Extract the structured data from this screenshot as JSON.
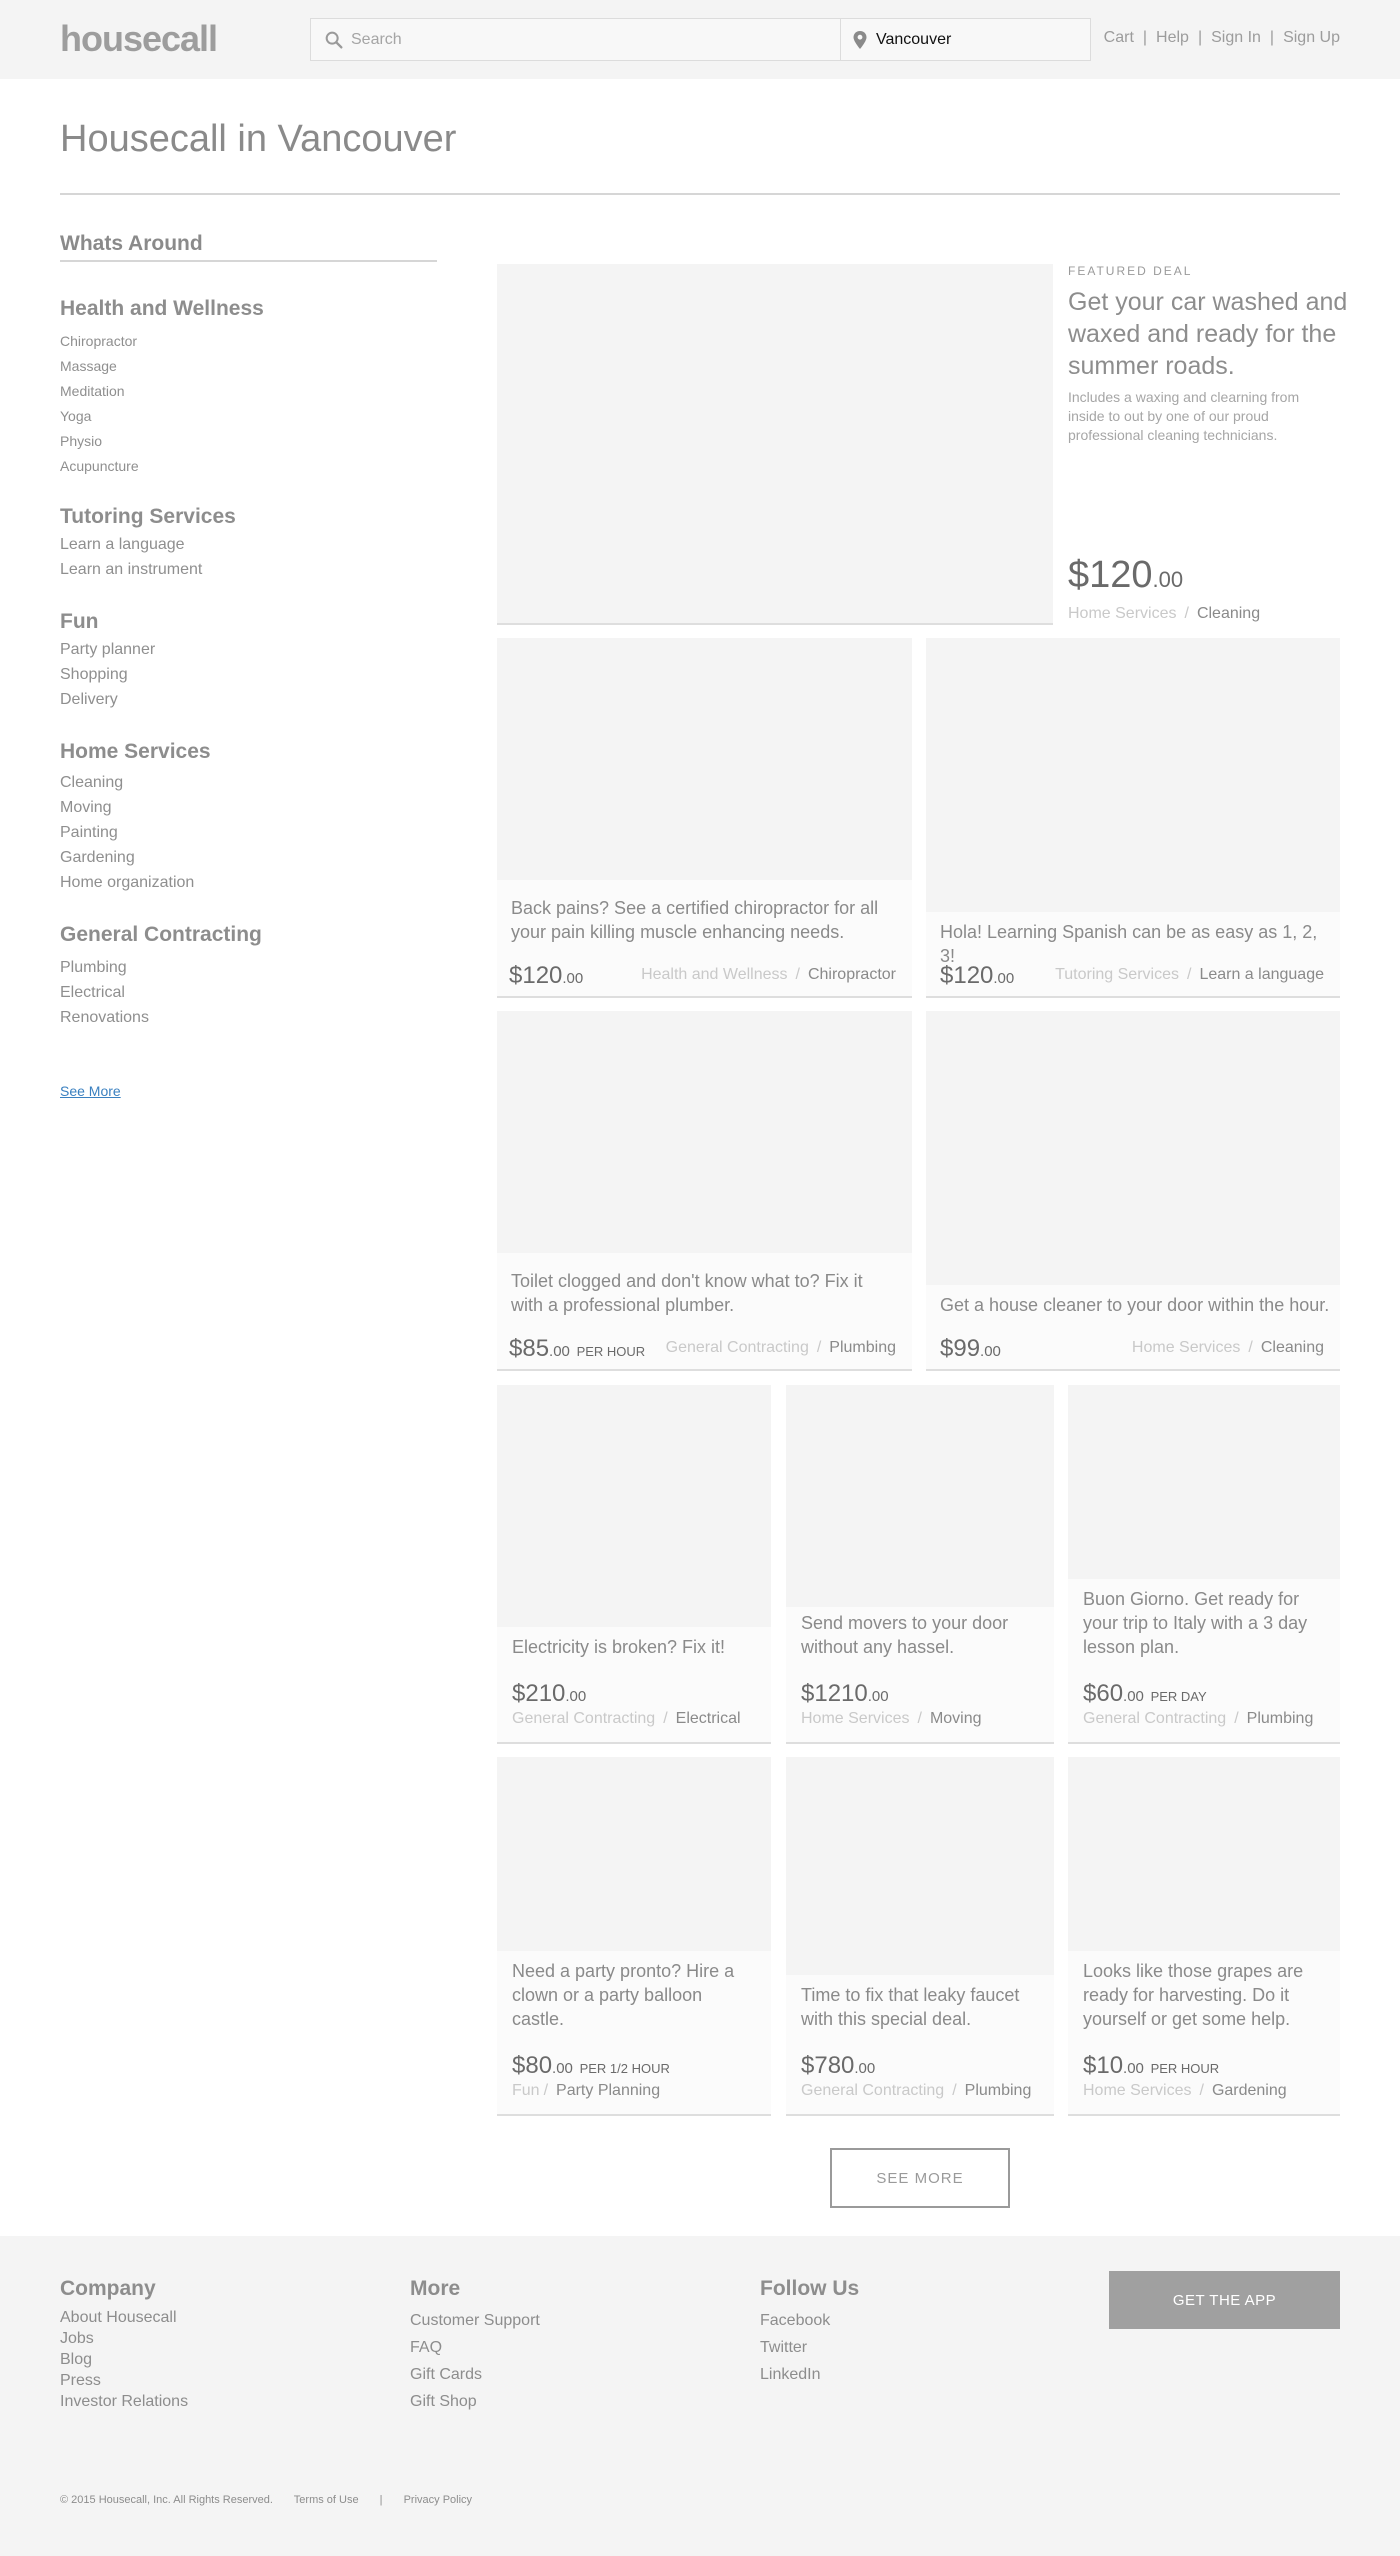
{
  "header": {
    "logo": "housecall",
    "search_placeholder": "Search",
    "location_value": "Vancouver",
    "nav": [
      "Cart",
      "Help",
      "Sign In",
      "Sign Up"
    ]
  },
  "page_title": "Housecall in Vancouver",
  "sidebar": {
    "heading": "Whats Around",
    "groups": [
      {
        "title": "Health and Wellness",
        "items": [
          "Chiropractor",
          "Massage",
          "Meditation",
          "Yoga",
          "Physio",
          "Acupuncture"
        ]
      },
      {
        "title": "Tutoring Services",
        "items": [
          "Learn a language",
          "Learn an instrument"
        ]
      },
      {
        "title": "Fun",
        "items": [
          "Party planner",
          "Shopping",
          "Delivery"
        ]
      },
      {
        "title": "Home Services",
        "items": [
          "Cleaning",
          "Moving",
          "Painting",
          "Gardening",
          "Home organization"
        ]
      },
      {
        "title": "General Contracting",
        "items": [
          "Plumbing",
          "Electrical",
          "Renovations"
        ]
      }
    ],
    "see_more": "See More"
  },
  "featured": {
    "eyebrow": "FEATURED DEAL",
    "title": "Get your car washed and waxed and ready for the summer roads.",
    "description": "Includes a waxing and clearning from inside to out by one of our proud professional cleaning technicians.",
    "price_dollars": "$120",
    "price_cents": ".00",
    "category": "Home Services",
    "subcategory": "Cleaning"
  },
  "deals": [
    {
      "desc": "Back pains? See a certified chiropractor for all your pain killing muscle enhancing needs.",
      "price": "$120",
      "cents": ".00",
      "unit": "",
      "category": "Health and Wellness",
      "sub": "Chiropractor"
    },
    {
      "desc": "Hola! Learning Spanish can be as easy as 1, 2, 3!",
      "price": "$120",
      "cents": ".00",
      "unit": "",
      "category": "Tutoring Services",
      "sub": "Learn a language"
    },
    {
      "desc": "Toilet clogged and don't know what to? Fix it with a professional plumber.",
      "price": "$85",
      "cents": ".00",
      "unit": "PER HOUR",
      "category": "General Contracting",
      "sub": "Plumbing"
    },
    {
      "desc": "Get a house cleaner to your door within the hour.",
      "price": "$99",
      "cents": ".00",
      "unit": "",
      "category": "Home Services",
      "sub": "Cleaning"
    },
    {
      "desc": "Electricity is broken? Fix it!",
      "price": "$210",
      "cents": ".00",
      "unit": "",
      "category": "General Contracting",
      "sub": "Electrical"
    },
    {
      "desc": "Send movers to your door without any hassel.",
      "price": "$1210",
      "cents": ".00",
      "unit": "",
      "category": "Home Services",
      "sub": "Moving"
    },
    {
      "desc": "Buon Giorno. Get ready for your trip to Italy with a 3 day lesson plan.",
      "price": "$60",
      "cents": ".00",
      "unit": "PER DAY",
      "category": "General Contracting",
      "sub": "Plumbing"
    },
    {
      "desc": "Need a party pronto? Hire a clown or a party balloon castle.",
      "price": "$80",
      "cents": ".00",
      "unit": "PER 1/2 HOUR",
      "category": "Fun",
      "sub": "Party Planning"
    },
    {
      "desc": "Time to fix that leaky faucet with this special deal.",
      "price": "$780",
      "cents": ".00",
      "unit": "",
      "category": "General Contracting",
      "sub": "Plumbing"
    },
    {
      "desc": "Looks like those grapes are ready for harvesting. Do it yourself or get some help.",
      "price": "$10",
      "cents": ".00",
      "unit": "PER HOUR",
      "category": "Home Services",
      "sub": "Gardening"
    }
  ],
  "see_more_button": "SEE MORE",
  "footer": {
    "company": {
      "title": "Company",
      "links": [
        "About Housecall",
        "Jobs",
        "Blog",
        "Press",
        "Investor Relations"
      ]
    },
    "more": {
      "title": "More",
      "links": [
        "Customer Support",
        "FAQ",
        "Gift Cards",
        "Gift Shop"
      ]
    },
    "follow": {
      "title": "Follow Us",
      "links": [
        "Facebook",
        "Twitter",
        "LinkedIn"
      ]
    },
    "get_app": "GET THE APP",
    "copyright": "© 2015 Housecall, Inc. All Rights Reserved.",
    "terms": "Terms of Use",
    "divider": "|",
    "privacy": "Privacy Policy"
  }
}
